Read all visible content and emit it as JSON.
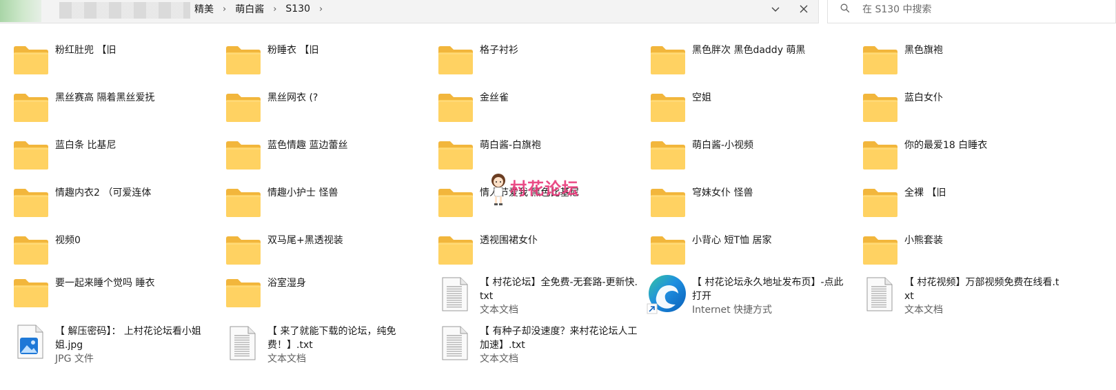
{
  "breadcrumb": {
    "items": [
      "精美",
      "萌白酱",
      "S130"
    ]
  },
  "search": {
    "placeholder": "在 S130 中搜索"
  },
  "icons": {
    "dropdown": "chevron-down-icon",
    "close": "close-icon",
    "search": "search-icon",
    "folder": "folder-icon",
    "text_file": "text-file-icon",
    "edge_shortcut": "edge-shortcut-icon",
    "image_file": "image-file-icon"
  },
  "colors": {
    "folder_front": "#ffd262",
    "folder_back": "#f2b63c",
    "sub_text": "#5f5f5f"
  },
  "items": [
    {
      "name": "粉红肚兜 【旧",
      "icon": "folder-thumb"
    },
    {
      "name": "粉睡衣 【旧",
      "icon": "folder-thumb"
    },
    {
      "name": "格子衬衫",
      "icon": "folder-thumb"
    },
    {
      "name": "黑色胖次 黑色daddy 萌黑",
      "icon": "folder"
    },
    {
      "name": "黑色旗袍",
      "icon": "folder"
    },
    {
      "name": "黑丝赛高 隔着黑丝爱抚",
      "icon": "folder"
    },
    {
      "name": "黑丝网衣 (?",
      "icon": "folder"
    },
    {
      "name": "金丝雀",
      "icon": "folder"
    },
    {
      "name": "空姐",
      "icon": "folder"
    },
    {
      "name": "蓝白女仆",
      "icon": "folder"
    },
    {
      "name": "蓝白条 比基尼",
      "icon": "folder"
    },
    {
      "name": "蓝色情趣 蓝边蕾丝",
      "icon": "folder"
    },
    {
      "name": "萌白酱-白旗袍",
      "icon": "folder"
    },
    {
      "name": "萌白酱-小视频",
      "icon": "folder"
    },
    {
      "name": "你的最爱18 白睡衣",
      "icon": "folder"
    },
    {
      "name": "情趣内衣2 （可爱连体",
      "icon": "folder"
    },
    {
      "name": "情趣小护士 怪兽",
      "icon": "folder"
    },
    {
      "name": "情人节爱我 黑色比基尼",
      "icon": "folder"
    },
    {
      "name": "穹妹女仆 怪兽",
      "icon": "folder"
    },
    {
      "name": "全裸 【旧",
      "icon": "folder"
    },
    {
      "name": "视频0",
      "icon": "folder"
    },
    {
      "name": "双马尾+黑透视装",
      "icon": "folder"
    },
    {
      "name": "透视围裙女仆",
      "icon": "folder"
    },
    {
      "name": "小背心 短T恤 居家",
      "icon": "folder"
    },
    {
      "name": "小熊套装",
      "icon": "folder"
    },
    {
      "name": "要一起来睡个觉吗 睡衣",
      "icon": "folder"
    },
    {
      "name": "浴室湿身",
      "icon": "folder"
    },
    {
      "name": "【 村花论坛】全免费-无套路-更新快.txt",
      "icon": "txt",
      "type": "文本文档"
    },
    {
      "name": "【 村花论坛永久地址发布页】-点此打开",
      "icon": "edge",
      "type": "Internet 快捷方式"
    },
    {
      "name": "【 村花视频】万部视频免费在线看.txt",
      "icon": "txt",
      "type": "文本文档"
    },
    {
      "name": "【 解压密码】： 上村花论坛看小姐姐.jpg",
      "icon": "jpg",
      "type": "JPG 文件"
    },
    {
      "name": "【 来了就能下载的论坛，纯免费！】.txt",
      "icon": "txt",
      "type": "文本文档"
    },
    {
      "name": "【 有种子却没速度？来村花论坛人工加速】.txt",
      "icon": "txt",
      "type": "文本文档"
    }
  ],
  "watermark": {
    "text": "村花论坛"
  }
}
